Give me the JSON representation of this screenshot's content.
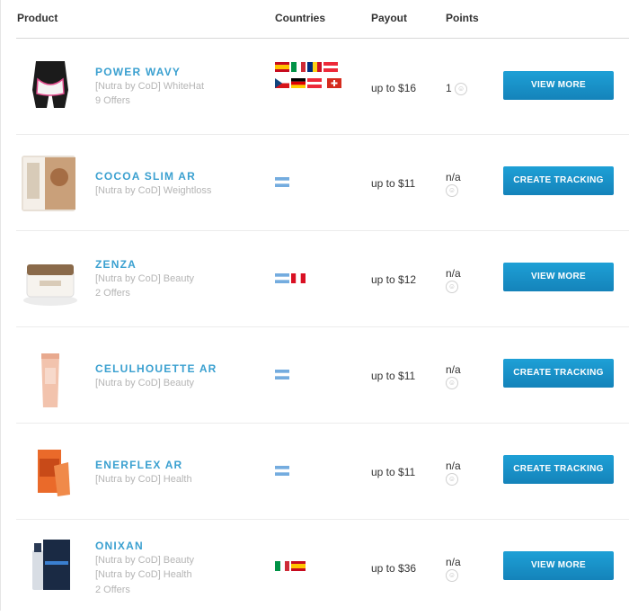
{
  "table": {
    "headers": {
      "product": "Product",
      "countries": "Countries",
      "payout": "Payout",
      "points": "Points"
    }
  },
  "rows": [
    {
      "name": "POWER WAVY",
      "lines": [
        "[Nutra by CoD] WhiteHat",
        "9 Offers"
      ],
      "payout": "up to $16",
      "points": "1",
      "button": "VIEW MORE",
      "flags": [
        "ES",
        "IT",
        "RO",
        "AT",
        "CZ",
        "DE",
        "AT",
        "CH"
      ],
      "image": "black-shorts"
    },
    {
      "name": "COCOA SLIM AR",
      "lines": [
        "[Nutra by CoD] Weightloss"
      ],
      "payout": "up to $11",
      "points": "n/a",
      "button": "CREATE TRACKING URL",
      "flags": [
        "AR"
      ],
      "image": "cocoa-pouch"
    },
    {
      "name": "ZENZA",
      "lines": [
        "[Nutra by CoD] Beauty",
        "2 Offers"
      ],
      "payout": "up to $12",
      "points": "n/a",
      "button": "VIEW MORE",
      "flags": [
        "AR",
        "PE"
      ],
      "image": "cream-jar"
    },
    {
      "name": "CELULHOUETTE AR",
      "lines": [
        "[Nutra by CoD] Beauty"
      ],
      "payout": "up to $11",
      "points": "n/a",
      "button": "CREATE TRACKING URL",
      "flags": [
        "AR"
      ],
      "image": "pink-tube"
    },
    {
      "name": "ENERFLEX AR",
      "lines": [
        "[Nutra by CoD] Health"
      ],
      "payout": "up to $11",
      "points": "n/a",
      "button": "CREATE TRACKING URL",
      "flags": [
        "AR"
      ],
      "image": "orange-box"
    },
    {
      "name": "ONIXAN",
      "lines": [
        "[Nutra by CoD] Beauty",
        "[Nutra by CoD] Health",
        "2 Offers"
      ],
      "payout": "up to $36",
      "points": "n/a",
      "button": "VIEW MORE",
      "flags": [
        "IT",
        "ES"
      ],
      "image": "spray-box"
    }
  ],
  "colors": {
    "accent": "#3aa0d0",
    "button": "#1a8fc6",
    "muted": "#b5b5b5"
  }
}
